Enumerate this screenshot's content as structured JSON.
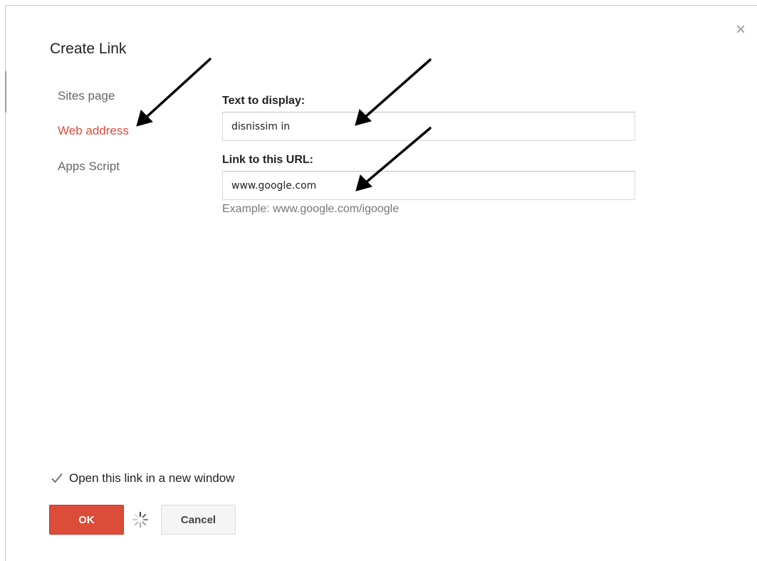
{
  "dialog": {
    "title": "Create Link",
    "close_symbol": "×"
  },
  "nav": {
    "items": [
      {
        "label": "Sites page",
        "active": false
      },
      {
        "label": "Web address",
        "active": true
      },
      {
        "label": "Apps Script",
        "active": false
      }
    ]
  },
  "form": {
    "text_label": "Text to display:",
    "text_value": "disnissim in",
    "url_label": "Link to this URL:",
    "url_value": "www.google.com",
    "example": "Example: www.google.com/igoogle"
  },
  "options": {
    "new_window_label": "Open this link in a new window",
    "new_window_checked": true
  },
  "buttons": {
    "ok_label": "OK",
    "cancel_label": "Cancel"
  },
  "icons": {
    "close": "close-icon",
    "checkbox": "checkmark-icon",
    "spinner": "loading-spinner-icon",
    "arrow": "arrow-icon"
  },
  "colors": {
    "accent": "#dd4b39",
    "nav_text": "#666666",
    "hint_text": "#777777"
  }
}
